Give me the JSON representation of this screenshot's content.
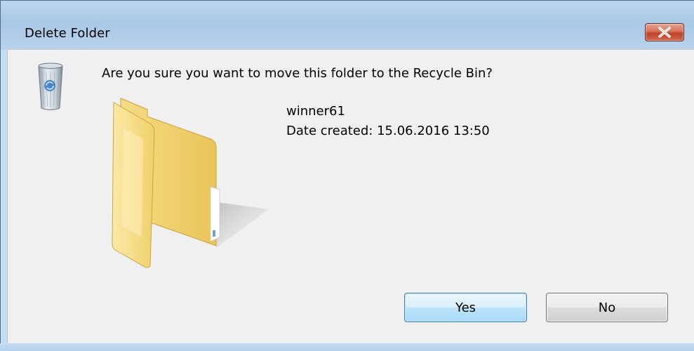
{
  "dialog": {
    "title": "Delete Folder",
    "question": "Are you sure you want to move this folder to the Recycle Bin?",
    "item": {
      "name": "winner61",
      "date_created": "Date created: 15.06.2016 13:50"
    }
  },
  "buttons": {
    "yes_label": "Yes",
    "no_label": "No"
  },
  "icons": {
    "close": "close-icon",
    "recycle_bin": "recycle-bin-icon",
    "folder": "folder-icon"
  },
  "colors": {
    "frame": "#b8d2ec",
    "client": "#f0f0f0",
    "close_button": "#c0412a",
    "default_button_border": "#3c7fb1",
    "folder": "#f5d77a"
  }
}
